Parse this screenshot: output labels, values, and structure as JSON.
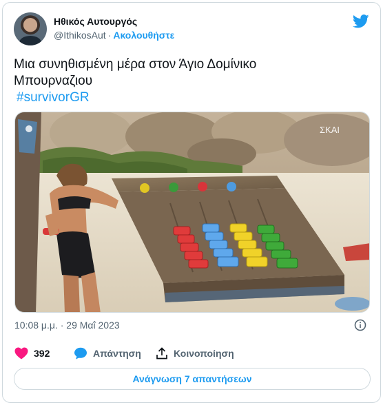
{
  "author": {
    "name": "Ηθικός Αυτουργός",
    "handle": "@IthikosAut",
    "separator": "·",
    "follow_label": "Ακολουθήστε"
  },
  "tweet": {
    "text_line1": "Μια συνηθισμένη μέρα στον Άγιο Δομίνικο",
    "text_line2": "Μπουρναζιου",
    "hashtag": "#survivorGR"
  },
  "media": {
    "channel_logo": "ΣΚΑΙ"
  },
  "meta": {
    "timestamp": "10:08 μ.μ. · 29 Μαΐ 2023"
  },
  "actions": {
    "likes": "392",
    "reply_label": "Απάντηση",
    "share_label": "Κοινοποίηση"
  },
  "read_replies_label": "Ανάγνωση 7 απαντήσεων",
  "colors": {
    "accent": "#1d9bf0",
    "like": "#f91880",
    "muted": "#536471",
    "border": "#cfd9de"
  },
  "icons": [
    "twitter-bird-icon",
    "info-icon",
    "heart-icon",
    "reply-bubble-icon",
    "share-icon"
  ]
}
